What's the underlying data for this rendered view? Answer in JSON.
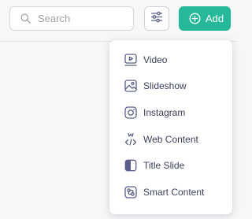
{
  "colors": {
    "accent": "#25b99a",
    "icon": "#5b5f8a",
    "text": "#3b3f5c"
  },
  "search": {
    "placeholder": "Search",
    "value": "",
    "icon": "search-icon"
  },
  "toolbar": {
    "filter_icon": "sliders-icon",
    "add_label": "Add",
    "add_icon": "plus-circle-icon"
  },
  "menu": {
    "items": [
      {
        "label": "Video",
        "icon": "video-icon"
      },
      {
        "label": "Slideshow",
        "icon": "slideshow-icon"
      },
      {
        "label": "Instagram",
        "icon": "instagram-icon"
      },
      {
        "label": "Web Content",
        "icon": "web-content-icon"
      },
      {
        "label": "Title Slide",
        "icon": "title-slide-icon"
      },
      {
        "label": "Smart Content",
        "icon": "smart-content-icon"
      }
    ]
  }
}
